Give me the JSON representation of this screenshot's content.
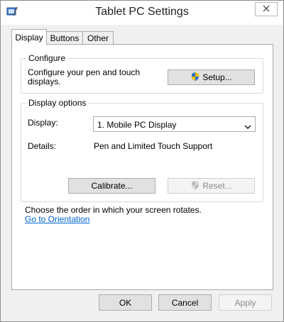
{
  "window": {
    "title": "Tablet PC Settings"
  },
  "tabs": [
    {
      "label": "Display",
      "active": true
    },
    {
      "label": "Buttons",
      "active": false
    },
    {
      "label": "Other",
      "active": false
    }
  ],
  "configure": {
    "group_label": "Configure",
    "description": "Configure your pen and touch displays.",
    "setup_label": "Setup..."
  },
  "display_options": {
    "group_label": "Display options",
    "display_label": "Display:",
    "display_value": "1. Mobile PC Display",
    "details_label": "Details:",
    "details_value": "Pen and Limited Touch Support",
    "calibrate_label": "Calibrate...",
    "reset_label": "Reset..."
  },
  "orientation": {
    "text": "Choose the order in which your screen rotates.",
    "link": "Go to Orientation"
  },
  "footer": {
    "ok_label": "OK",
    "cancel_label": "Cancel",
    "apply_label": "Apply"
  },
  "colors": {
    "link": "#0066cc",
    "shield_blue": "#2f6fc9",
    "shield_yellow": "#f2c200"
  }
}
